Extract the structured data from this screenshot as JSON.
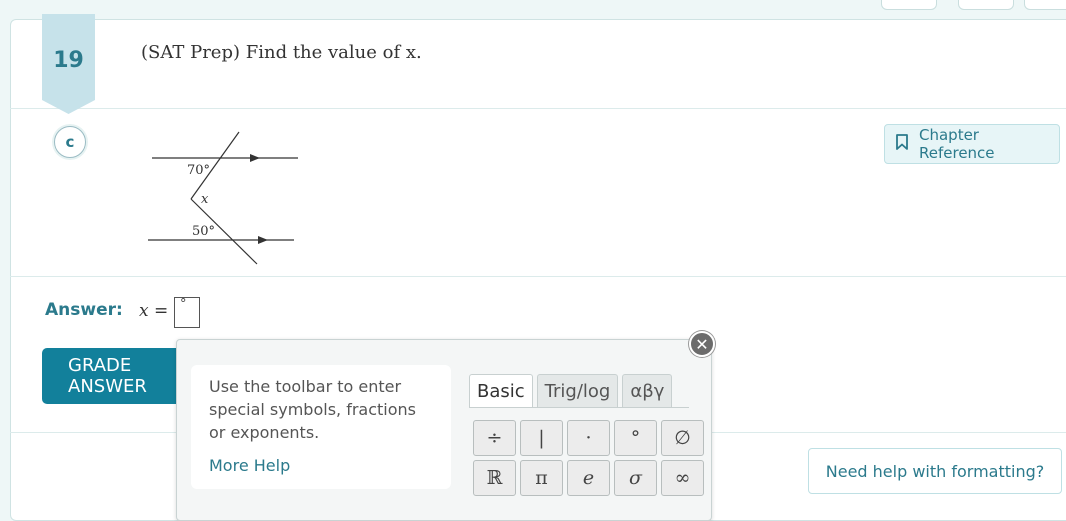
{
  "question": {
    "number": "19",
    "text": "(SAT Prep) Find the value of x.",
    "badge": "c"
  },
  "figure": {
    "top_angle": "70°",
    "middle_var": "x",
    "bottom_angle": "50°"
  },
  "chapter_reference": {
    "label": "Chapter Reference",
    "icon": "bookmark-icon"
  },
  "answer": {
    "label": "Answer:",
    "expression": "x =",
    "value": "°"
  },
  "grade_button": {
    "label": "GRADE ANSWER"
  },
  "toolbar_popup": {
    "help_text": "Use the toolbar to enter special symbols, fractions or exponents.",
    "more_help": "More Help",
    "tabs": [
      "Basic",
      "Trig/log",
      "αβγ"
    ],
    "active_tab": "Basic",
    "keys": [
      "÷",
      "|",
      "·",
      "°",
      "∅",
      "ℝ",
      "π",
      "e",
      "σ",
      "∞"
    ]
  },
  "format_help": {
    "label": "Need help with formatting?"
  },
  "colors": {
    "accent": "#2b7a8c",
    "button": "#12809b"
  }
}
